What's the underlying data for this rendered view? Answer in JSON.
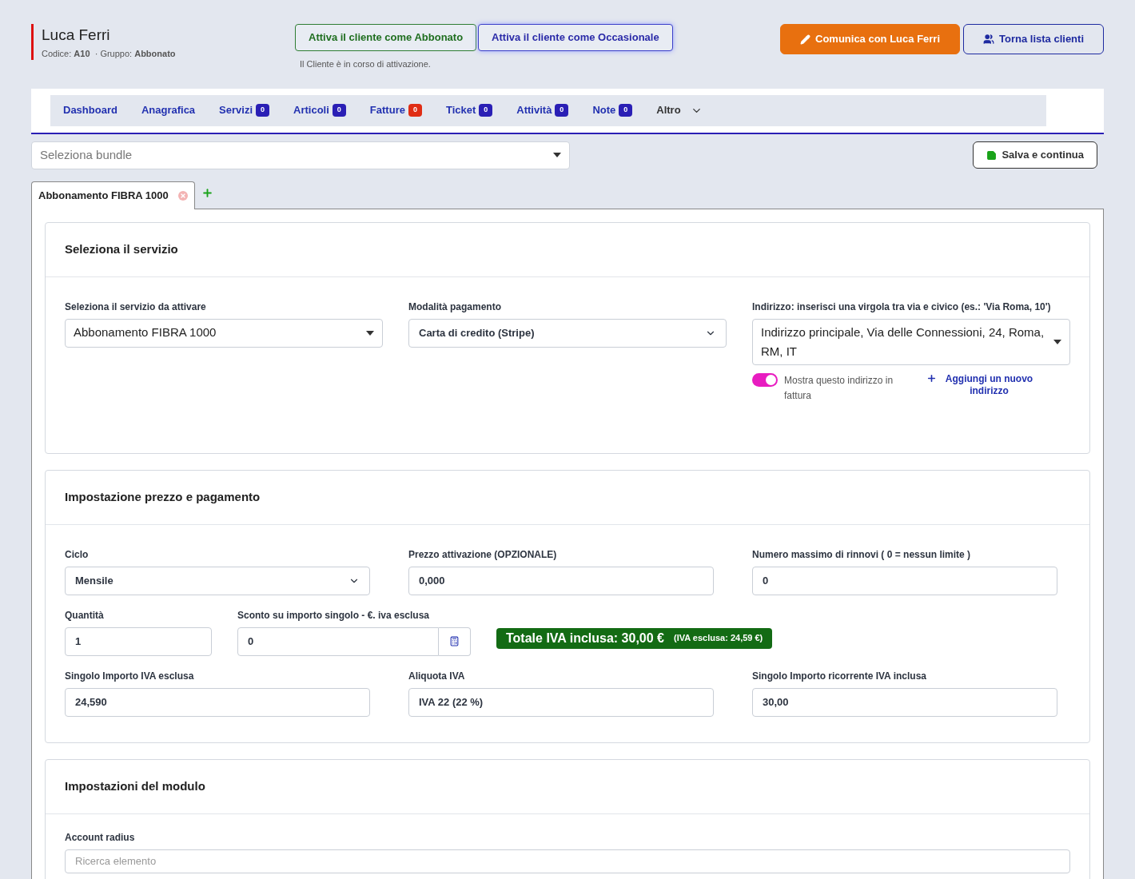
{
  "client": {
    "name": "Luca Ferri",
    "code_label": "Codice:",
    "code": "A10",
    "group_label": "· Gruppo:",
    "group": "Abbonato"
  },
  "activation": {
    "buttons": [
      {
        "label": "Attiva il cliente come Abbonato",
        "kind": "green"
      },
      {
        "label": "Attiva il cliente come Occasionale",
        "kind": "blue"
      }
    ],
    "status": "Il Cliente è in corso di attivazione."
  },
  "actions": [
    {
      "label": "Comunica con Luca Ferri",
      "kind": "primary"
    },
    {
      "label": "Torna lista clienti",
      "kind": "outline"
    }
  ],
  "nav": [
    {
      "label": "Dashboard"
    },
    {
      "label": "Anagrafica"
    },
    {
      "label": "Servizi",
      "badge": "0",
      "color": "#2a1fb5"
    },
    {
      "label": "Articoli",
      "badge": "0",
      "color": "#2a1fb5"
    },
    {
      "label": "Fatture",
      "badge": "0",
      "color": "#e02d14"
    },
    {
      "label": "Ticket",
      "badge": "0",
      "color": "#2a1fb5"
    },
    {
      "label": "Attività",
      "badge": "0",
      "color": "#2a1fb5"
    },
    {
      "label": "Note",
      "badge": "0",
      "color": "#2a1fb5"
    },
    {
      "label": "Altro",
      "dropdown": true
    }
  ],
  "bundle": {
    "placeholder": "Seleziona bundle"
  },
  "save_button": "Salva e continua",
  "service_tabs": [
    {
      "label": "Abbonamento FIBRA 1000",
      "selected": true
    }
  ],
  "section_service": {
    "title": "Seleziona il servizio",
    "service": {
      "label": "Seleziona il servizio da attivare",
      "value": "Abbonamento FIBRA 1000"
    },
    "payment": {
      "label": "Modalità pagamento",
      "value": "Carta di credito (Stripe)"
    },
    "address": {
      "label": "Indirizzo: inserisci una virgola tra via e civico (es.: 'Via Roma, 10')",
      "value": "Indirizzo principale, Via delle Connessioni, 24, Roma, RM, IT"
    },
    "show_on_invoice": {
      "label": "Mostra questo indirizzo in fattura",
      "on": true
    },
    "add_address": "Aggiungi un nuovo indirizzo"
  },
  "section_price": {
    "title": "Impostazione prezzo e pagamento",
    "cycle": {
      "label": "Ciclo",
      "value": "Mensile"
    },
    "activation_price": {
      "label": "Prezzo attivazione (OPZIONALE)",
      "value": "0,000"
    },
    "max_renewals": {
      "label": "Numero massimo di rinnovi ( 0 = nessun limite )",
      "value": "0"
    },
    "quantity": {
      "label": "Quantità",
      "value": "1"
    },
    "discount": {
      "label": "Sconto su importo singolo - €. iva esclusa",
      "value": "0"
    },
    "total": {
      "main": "Totale IVA inclusa: 30,00 €",
      "sub": "(IVA esclusa: 24,59 €)"
    },
    "net_amount": {
      "label": "Singolo Importo IVA esclusa",
      "value": "24,590"
    },
    "vat_rate": {
      "label": "Aliquota IVA",
      "value": "IVA 22 (22 %)"
    },
    "gross_amount": {
      "label": "Singolo Importo ricorrente IVA inclusa",
      "value": "30,00"
    }
  },
  "section_module": {
    "title": "Impostazioni del modulo",
    "account": {
      "label": "Account radius",
      "placeholder": "Ricerca elemento"
    }
  }
}
